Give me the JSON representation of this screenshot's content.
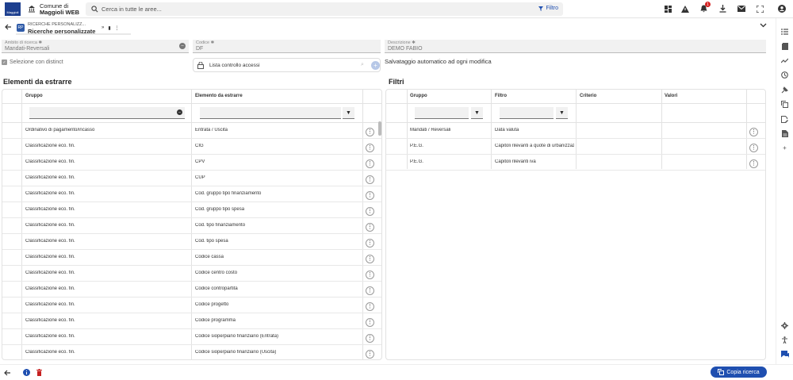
{
  "header": {
    "logo_text": "Maggioli",
    "app_name_line1": "Comune di",
    "app_name_line2": "Maggioli WEB",
    "search_placeholder": "Cerca in tutte le aree...",
    "filter_label": "Filtro",
    "notification_count": "1"
  },
  "breadcrumb": {
    "parent": "RICERCHE PERSONALIZZ...",
    "title": "Ricerche personalizzate",
    "icon_text": "RP"
  },
  "form": {
    "ambito_label": "Ambito di ricerca",
    "ambito_value": "Mandati-Reversali",
    "codice_label": "Codice",
    "codice_value": "DF",
    "descrizione_label": "Descrizione",
    "descrizione_value": "DEMO FABIO",
    "distinct_label": "Selezione con distinct",
    "lista_value": "Lista controllo accessi",
    "autosave_text": "Salvataggio automatico ad ogni modifica"
  },
  "elementi": {
    "title": "Elementi da estrarre",
    "columns": [
      "Gruppo",
      "Elemento da estrarre"
    ],
    "rows": [
      [
        "Ordinativo di pagamento/incasso",
        "Entrata / Uscita"
      ],
      [
        "Classificazione eco. fin.",
        "CIG"
      ],
      [
        "Classificazione eco. fin.",
        "CPV"
      ],
      [
        "Classificazione eco. fin.",
        "CUP"
      ],
      [
        "Classificazione eco. fin.",
        "Cod. gruppo tipo finanziamento"
      ],
      [
        "Classificazione eco. fin.",
        "Cod. gruppo tipo spesa"
      ],
      [
        "Classificazione eco. fin.",
        "Cod. tipo finanziamento"
      ],
      [
        "Classificazione eco. fin.",
        "Cod. tipo spesa"
      ],
      [
        "Classificazione eco. fin.",
        "Codice cassa"
      ],
      [
        "Classificazione eco. fin.",
        "Codice centro costo"
      ],
      [
        "Classificazione eco. fin.",
        "Codice contropartita"
      ],
      [
        "Classificazione eco. fin.",
        "Codice progetto"
      ],
      [
        "Classificazione eco. fin.",
        "Codice programma"
      ],
      [
        "Classificazione eco. fin.",
        "Codice siope/piano finanziario (Entrata)"
      ],
      [
        "Classificazione eco. fin.",
        "Codice siope/piano finanziario (Uscita)"
      ]
    ]
  },
  "filtri": {
    "title": "Filtri",
    "columns": [
      "Gruppo",
      "Filtro",
      "Criterio",
      "Valori"
    ],
    "rows": [
      [
        "Mandati / Reversali",
        "Data valuta",
        "",
        ""
      ],
      [
        "P.E.G.",
        "Capitoli rilevanti a quote di urbanizzazione",
        "",
        ""
      ],
      [
        "P.E.G.",
        "Capitoli rilevanti iva",
        "",
        ""
      ]
    ]
  },
  "footer": {
    "copy_label": "Copia ricerca"
  }
}
